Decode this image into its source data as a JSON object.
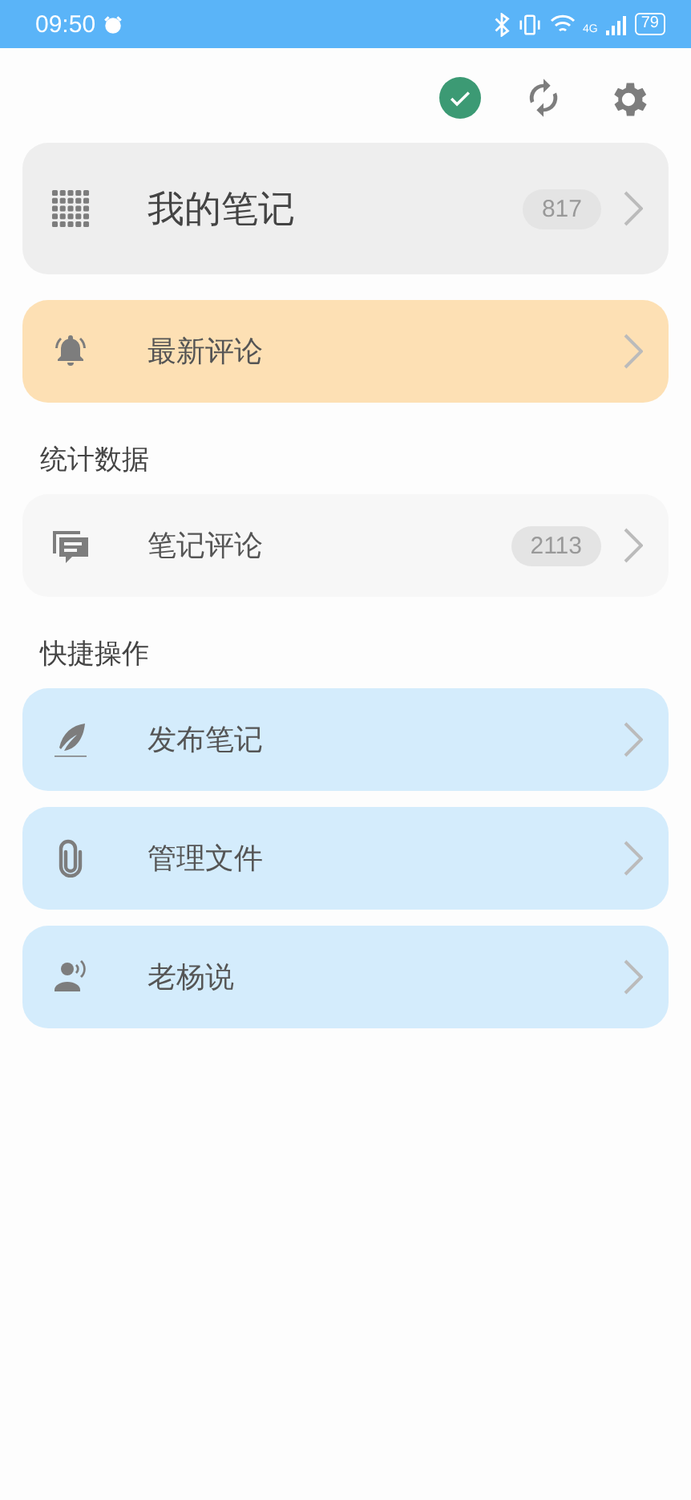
{
  "status_bar": {
    "time": "09:50",
    "network": "4G",
    "battery": "79"
  },
  "toolbar": {
    "buttons": [
      {
        "kind": "check"
      },
      {
        "kind": "sync"
      },
      {
        "kind": "settings"
      }
    ]
  },
  "sections": [
    {
      "items": [
        {
          "kind": "grid",
          "label": "我的笔记",
          "badge": "817",
          "color": "#eeeeee",
          "large": true
        }
      ]
    },
    {
      "items": [
        {
          "kind": "bell",
          "label": "最新评论",
          "color": "#fde0b4",
          "large": false
        }
      ]
    },
    {
      "title": "统计数据",
      "items": [
        {
          "kind": "comments",
          "label": "笔记评论",
          "badge": "2113",
          "color": "#f7f7f7",
          "large": false
        }
      ]
    },
    {
      "title": "快捷操作",
      "items": [
        {
          "kind": "feather",
          "label": "发布笔记",
          "color": "#d4ecfc",
          "large": false
        },
        {
          "kind": "clip",
          "label": "管理文件",
          "color": "#d4ecfc",
          "large": false
        },
        {
          "kind": "speaker",
          "label": "老杨说",
          "color": "#d4ecfc",
          "large": false
        }
      ]
    }
  ]
}
